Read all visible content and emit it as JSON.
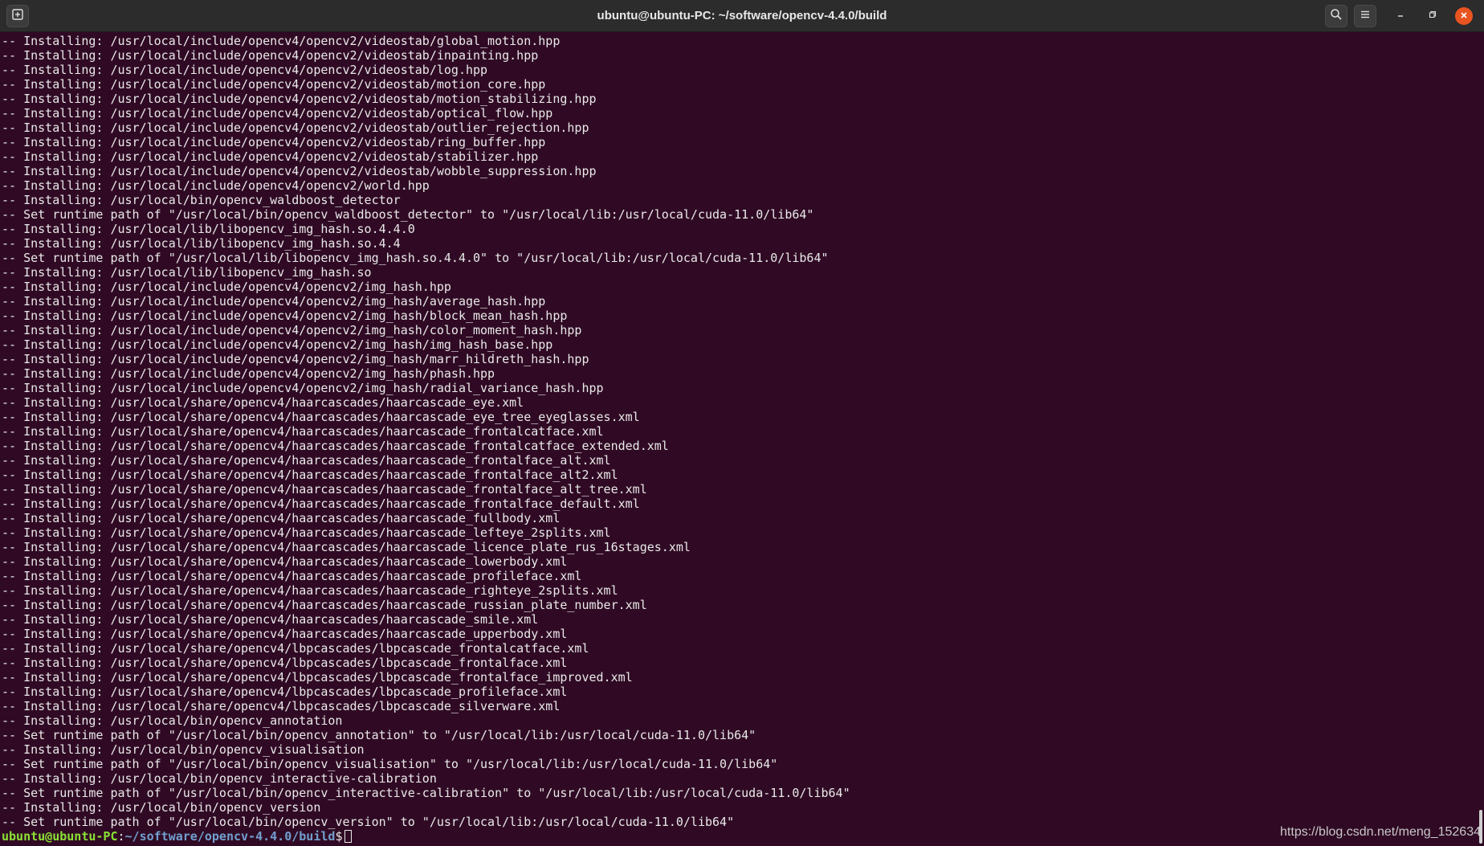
{
  "window": {
    "title": "ubuntu@ubuntu-PC: ~/software/opencv-4.4.0/build"
  },
  "terminal": {
    "lines": [
      "-- Installing: /usr/local/include/opencv4/opencv2/videostab/global_motion.hpp",
      "-- Installing: /usr/local/include/opencv4/opencv2/videostab/inpainting.hpp",
      "-- Installing: /usr/local/include/opencv4/opencv2/videostab/log.hpp",
      "-- Installing: /usr/local/include/opencv4/opencv2/videostab/motion_core.hpp",
      "-- Installing: /usr/local/include/opencv4/opencv2/videostab/motion_stabilizing.hpp",
      "-- Installing: /usr/local/include/opencv4/opencv2/videostab/optical_flow.hpp",
      "-- Installing: /usr/local/include/opencv4/opencv2/videostab/outlier_rejection.hpp",
      "-- Installing: /usr/local/include/opencv4/opencv2/videostab/ring_buffer.hpp",
      "-- Installing: /usr/local/include/opencv4/opencv2/videostab/stabilizer.hpp",
      "-- Installing: /usr/local/include/opencv4/opencv2/videostab/wobble_suppression.hpp",
      "-- Installing: /usr/local/include/opencv4/opencv2/world.hpp",
      "-- Installing: /usr/local/bin/opencv_waldboost_detector",
      "-- Set runtime path of \"/usr/local/bin/opencv_waldboost_detector\" to \"/usr/local/lib:/usr/local/cuda-11.0/lib64\"",
      "-- Installing: /usr/local/lib/libopencv_img_hash.so.4.4.0",
      "-- Installing: /usr/local/lib/libopencv_img_hash.so.4.4",
      "-- Set runtime path of \"/usr/local/lib/libopencv_img_hash.so.4.4.0\" to \"/usr/local/lib:/usr/local/cuda-11.0/lib64\"",
      "-- Installing: /usr/local/lib/libopencv_img_hash.so",
      "-- Installing: /usr/local/include/opencv4/opencv2/img_hash.hpp",
      "-- Installing: /usr/local/include/opencv4/opencv2/img_hash/average_hash.hpp",
      "-- Installing: /usr/local/include/opencv4/opencv2/img_hash/block_mean_hash.hpp",
      "-- Installing: /usr/local/include/opencv4/opencv2/img_hash/color_moment_hash.hpp",
      "-- Installing: /usr/local/include/opencv4/opencv2/img_hash/img_hash_base.hpp",
      "-- Installing: /usr/local/include/opencv4/opencv2/img_hash/marr_hildreth_hash.hpp",
      "-- Installing: /usr/local/include/opencv4/opencv2/img_hash/phash.hpp",
      "-- Installing: /usr/local/include/opencv4/opencv2/img_hash/radial_variance_hash.hpp",
      "-- Installing: /usr/local/share/opencv4/haarcascades/haarcascade_eye.xml",
      "-- Installing: /usr/local/share/opencv4/haarcascades/haarcascade_eye_tree_eyeglasses.xml",
      "-- Installing: /usr/local/share/opencv4/haarcascades/haarcascade_frontalcatface.xml",
      "-- Installing: /usr/local/share/opencv4/haarcascades/haarcascade_frontalcatface_extended.xml",
      "-- Installing: /usr/local/share/opencv4/haarcascades/haarcascade_frontalface_alt.xml",
      "-- Installing: /usr/local/share/opencv4/haarcascades/haarcascade_frontalface_alt2.xml",
      "-- Installing: /usr/local/share/opencv4/haarcascades/haarcascade_frontalface_alt_tree.xml",
      "-- Installing: /usr/local/share/opencv4/haarcascades/haarcascade_frontalface_default.xml",
      "-- Installing: /usr/local/share/opencv4/haarcascades/haarcascade_fullbody.xml",
      "-- Installing: /usr/local/share/opencv4/haarcascades/haarcascade_lefteye_2splits.xml",
      "-- Installing: /usr/local/share/opencv4/haarcascades/haarcascade_licence_plate_rus_16stages.xml",
      "-- Installing: /usr/local/share/opencv4/haarcascades/haarcascade_lowerbody.xml",
      "-- Installing: /usr/local/share/opencv4/haarcascades/haarcascade_profileface.xml",
      "-- Installing: /usr/local/share/opencv4/haarcascades/haarcascade_righteye_2splits.xml",
      "-- Installing: /usr/local/share/opencv4/haarcascades/haarcascade_russian_plate_number.xml",
      "-- Installing: /usr/local/share/opencv4/haarcascades/haarcascade_smile.xml",
      "-- Installing: /usr/local/share/opencv4/haarcascades/haarcascade_upperbody.xml",
      "-- Installing: /usr/local/share/opencv4/lbpcascades/lbpcascade_frontalcatface.xml",
      "-- Installing: /usr/local/share/opencv4/lbpcascades/lbpcascade_frontalface.xml",
      "-- Installing: /usr/local/share/opencv4/lbpcascades/lbpcascade_frontalface_improved.xml",
      "-- Installing: /usr/local/share/opencv4/lbpcascades/lbpcascade_profileface.xml",
      "-- Installing: /usr/local/share/opencv4/lbpcascades/lbpcascade_silverware.xml",
      "-- Installing: /usr/local/bin/opencv_annotation",
      "-- Set runtime path of \"/usr/local/bin/opencv_annotation\" to \"/usr/local/lib:/usr/local/cuda-11.0/lib64\"",
      "-- Installing: /usr/local/bin/opencv_visualisation",
      "-- Set runtime path of \"/usr/local/bin/opencv_visualisation\" to \"/usr/local/lib:/usr/local/cuda-11.0/lib64\"",
      "-- Installing: /usr/local/bin/opencv_interactive-calibration",
      "-- Set runtime path of \"/usr/local/bin/opencv_interactive-calibration\" to \"/usr/local/lib:/usr/local/cuda-11.0/lib64\"",
      "-- Installing: /usr/local/bin/opencv_version",
      "-- Set runtime path of \"/usr/local/bin/opencv_version\" to \"/usr/local/lib:/usr/local/cuda-11.0/lib64\""
    ],
    "prompt": {
      "user_host": "ubuntu@ubuntu-PC",
      "separator": ":",
      "path": "~/software/opencv-4.4.0/build",
      "symbol": "$"
    }
  },
  "watermark": "https://blog.csdn.net/meng_152634",
  "colors": {
    "terminal_bg": "#300a24",
    "titlebar_bg": "#2c2c2c",
    "prompt_user": "#8ae234",
    "prompt_path": "#729fcf",
    "close_button": "#e95420"
  },
  "icons": {
    "new_tab": "new-tab-icon",
    "search": "search-icon",
    "menu": "hamburger-menu-icon",
    "minimize": "minimize-icon",
    "maximize": "maximize-icon",
    "close": "close-icon"
  }
}
